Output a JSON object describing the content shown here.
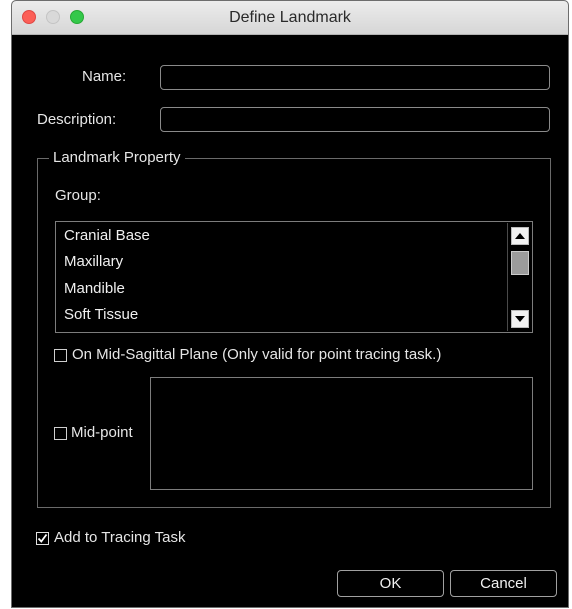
{
  "window": {
    "title": "Define Landmark"
  },
  "form": {
    "name_label": "Name:",
    "name_value": "",
    "description_label": "Description:",
    "description_value": ""
  },
  "property": {
    "legend": "Landmark Property",
    "group_label": "Group:",
    "groups": [
      "Cranial Base",
      "Maxillary",
      "Mandible",
      "Soft Tissue"
    ],
    "mid_sagittal_label": "On Mid-Sagittal Plane (Only valid for point tracing task.)",
    "mid_sagittal_checked": false,
    "mid_point_label": "Mid-point",
    "mid_point_checked": false
  },
  "add_to_tracing": {
    "label": "Add to Tracing Task",
    "checked": true
  },
  "buttons": {
    "ok": "OK",
    "cancel": "Cancel"
  }
}
